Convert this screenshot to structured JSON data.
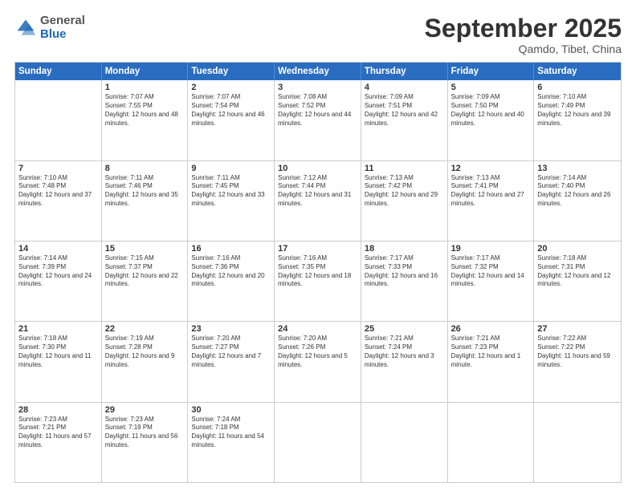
{
  "logo": {
    "general": "General",
    "blue": "Blue"
  },
  "title": {
    "month": "September 2025",
    "location": "Qamdo, Tibet, China"
  },
  "calendar": {
    "headers": [
      "Sunday",
      "Monday",
      "Tuesday",
      "Wednesday",
      "Thursday",
      "Friday",
      "Saturday"
    ],
    "rows": [
      [
        {
          "day": "",
          "empty": true
        },
        {
          "day": "1",
          "sunrise": "7:07 AM",
          "sunset": "7:55 PM",
          "daylight": "12 hours and 48 minutes."
        },
        {
          "day": "2",
          "sunrise": "7:07 AM",
          "sunset": "7:54 PM",
          "daylight": "12 hours and 46 minutes."
        },
        {
          "day": "3",
          "sunrise": "7:08 AM",
          "sunset": "7:52 PM",
          "daylight": "12 hours and 44 minutes."
        },
        {
          "day": "4",
          "sunrise": "7:09 AM",
          "sunset": "7:51 PM",
          "daylight": "12 hours and 42 minutes."
        },
        {
          "day": "5",
          "sunrise": "7:09 AM",
          "sunset": "7:50 PM",
          "daylight": "12 hours and 40 minutes."
        },
        {
          "day": "6",
          "sunrise": "7:10 AM",
          "sunset": "7:49 PM",
          "daylight": "12 hours and 39 minutes."
        }
      ],
      [
        {
          "day": "7",
          "sunrise": "7:10 AM",
          "sunset": "7:48 PM",
          "daylight": "12 hours and 37 minutes."
        },
        {
          "day": "8",
          "sunrise": "7:11 AM",
          "sunset": "7:46 PM",
          "daylight": "12 hours and 35 minutes."
        },
        {
          "day": "9",
          "sunrise": "7:11 AM",
          "sunset": "7:45 PM",
          "daylight": "12 hours and 33 minutes."
        },
        {
          "day": "10",
          "sunrise": "7:12 AM",
          "sunset": "7:44 PM",
          "daylight": "12 hours and 31 minutes."
        },
        {
          "day": "11",
          "sunrise": "7:13 AM",
          "sunset": "7:42 PM",
          "daylight": "12 hours and 29 minutes."
        },
        {
          "day": "12",
          "sunrise": "7:13 AM",
          "sunset": "7:41 PM",
          "daylight": "12 hours and 27 minutes."
        },
        {
          "day": "13",
          "sunrise": "7:14 AM",
          "sunset": "7:40 PM",
          "daylight": "12 hours and 26 minutes."
        }
      ],
      [
        {
          "day": "14",
          "sunrise": "7:14 AM",
          "sunset": "7:39 PM",
          "daylight": "12 hours and 24 minutes."
        },
        {
          "day": "15",
          "sunrise": "7:15 AM",
          "sunset": "7:37 PM",
          "daylight": "12 hours and 22 minutes."
        },
        {
          "day": "16",
          "sunrise": "7:16 AM",
          "sunset": "7:36 PM",
          "daylight": "12 hours and 20 minutes."
        },
        {
          "day": "17",
          "sunrise": "7:16 AM",
          "sunset": "7:35 PM",
          "daylight": "12 hours and 18 minutes."
        },
        {
          "day": "18",
          "sunrise": "7:17 AM",
          "sunset": "7:33 PM",
          "daylight": "12 hours and 16 minutes."
        },
        {
          "day": "19",
          "sunrise": "7:17 AM",
          "sunset": "7:32 PM",
          "daylight": "12 hours and 14 minutes."
        },
        {
          "day": "20",
          "sunrise": "7:18 AM",
          "sunset": "7:31 PM",
          "daylight": "12 hours and 12 minutes."
        }
      ],
      [
        {
          "day": "21",
          "sunrise": "7:18 AM",
          "sunset": "7:30 PM",
          "daylight": "12 hours and 11 minutes."
        },
        {
          "day": "22",
          "sunrise": "7:19 AM",
          "sunset": "7:28 PM",
          "daylight": "12 hours and 9 minutes."
        },
        {
          "day": "23",
          "sunrise": "7:20 AM",
          "sunset": "7:27 PM",
          "daylight": "12 hours and 7 minutes."
        },
        {
          "day": "24",
          "sunrise": "7:20 AM",
          "sunset": "7:26 PM",
          "daylight": "12 hours and 5 minutes."
        },
        {
          "day": "25",
          "sunrise": "7:21 AM",
          "sunset": "7:24 PM",
          "daylight": "12 hours and 3 minutes."
        },
        {
          "day": "26",
          "sunrise": "7:21 AM",
          "sunset": "7:23 PM",
          "daylight": "12 hours and 1 minute."
        },
        {
          "day": "27",
          "sunrise": "7:22 AM",
          "sunset": "7:22 PM",
          "daylight": "11 hours and 59 minutes."
        }
      ],
      [
        {
          "day": "28",
          "sunrise": "7:23 AM",
          "sunset": "7:21 PM",
          "daylight": "11 hours and 57 minutes."
        },
        {
          "day": "29",
          "sunrise": "7:23 AM",
          "sunset": "7:19 PM",
          "daylight": "11 hours and 56 minutes."
        },
        {
          "day": "30",
          "sunrise": "7:24 AM",
          "sunset": "7:18 PM",
          "daylight": "11 hours and 54 minutes."
        },
        {
          "day": "",
          "empty": true
        },
        {
          "day": "",
          "empty": true
        },
        {
          "day": "",
          "empty": true
        },
        {
          "day": "",
          "empty": true
        }
      ]
    ]
  }
}
